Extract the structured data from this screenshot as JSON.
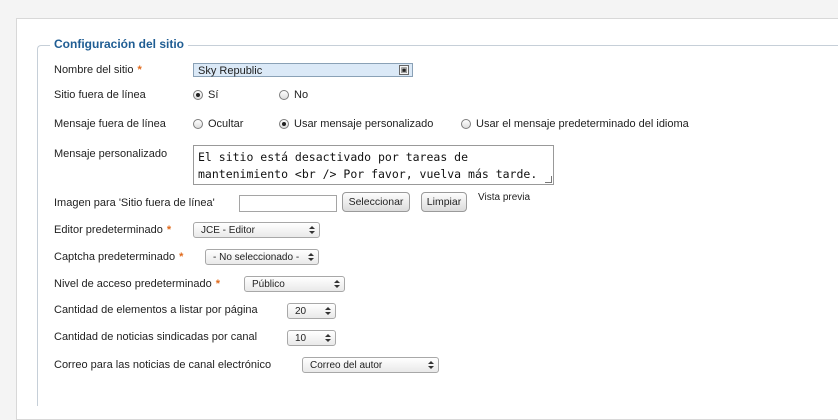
{
  "section_title": "Configuración del sitio",
  "fields": {
    "site_name": {
      "label": "Nombre del sitio",
      "required": "*",
      "value": "Sky Republic"
    },
    "offline": {
      "label": "Sitio fuera de línea",
      "options": [
        "Sí",
        "No"
      ],
      "selected": "Sí"
    },
    "offline_message": {
      "label": "Mensaje fuera de línea",
      "options": [
        "Ocultar",
        "Usar mensaje personalizado",
        "Usar el mensaje predeterminado del idioma"
      ],
      "selected": "Usar mensaje personalizado"
    },
    "custom_message": {
      "label": "Mensaje personalizado",
      "value": "El sitio está desactivado por tareas de mantenimiento <br /> Por favor, vuelva más tarde."
    },
    "offline_image": {
      "label": "Imagen para 'Sitio fuera de línea'",
      "select_button": "Seleccionar",
      "clear_button": "Limpiar",
      "preview_label": "Vista previa"
    },
    "default_editor": {
      "label": "Editor predeterminado",
      "required": "*",
      "value": "JCE - Editor"
    },
    "default_captcha": {
      "label": "Captcha predeterminado",
      "required": "*",
      "value": "- No seleccionado -"
    },
    "default_access": {
      "label": "Nivel de acceso predeterminado",
      "required": "*",
      "value": "Público"
    },
    "list_limit": {
      "label": "Cantidad de elementos a listar por página",
      "value": "20"
    },
    "feed_limit": {
      "label": "Cantidad de noticias sindicadas por canal",
      "value": "10"
    },
    "feed_email": {
      "label": "Correo para las noticias de canal electrónico",
      "value": "Correo del autor"
    }
  },
  "colors": {
    "accent": "#1f5d93",
    "required": "#e06a1c",
    "input_highlight": "#dbe9f7"
  },
  "icons": {
    "text_input_icon": "keyboard-icon",
    "select_arrows": "updown-arrows-icon",
    "textarea_resize": "resize-grip-icon"
  }
}
